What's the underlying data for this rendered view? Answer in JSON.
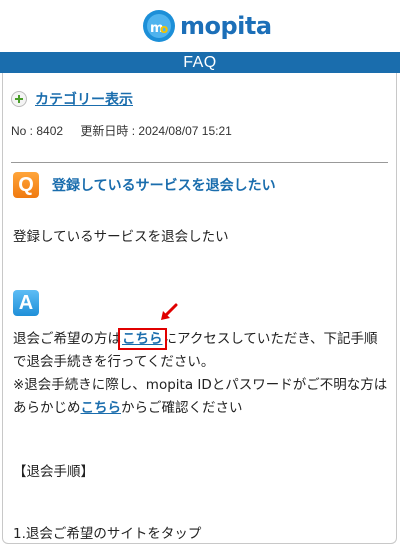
{
  "brand": {
    "name": "mopita",
    "mark_letters": "mo",
    "color": "#1c6fb8"
  },
  "header": {
    "section_title": "FAQ",
    "bar_color": "#1a6dad"
  },
  "category": {
    "link_label": "カテゴリー表示"
  },
  "meta": {
    "number": "No : 8402",
    "updated": "更新日時 : 2024/08/07 15:21"
  },
  "question": {
    "badge": "Q",
    "title": "登録しているサービスを退会したい",
    "body": "登録しているサービスを退会したい"
  },
  "answer": {
    "badge": "A",
    "line1_pre": "退会ご希望の方は",
    "link1": "こちら",
    "line1_post": "にアクセスしていただき、下記手順で退会手続きを行ってください。",
    "line2_pre": "※退会手続きに際し、mopita IDとパスワードがご不明な方はあらかじめ",
    "link2": "こちら",
    "line2_post": "からご確認ください",
    "steps_title": "【退会手順】",
    "step1": "1.退会ご希望のサイトをタップ"
  }
}
